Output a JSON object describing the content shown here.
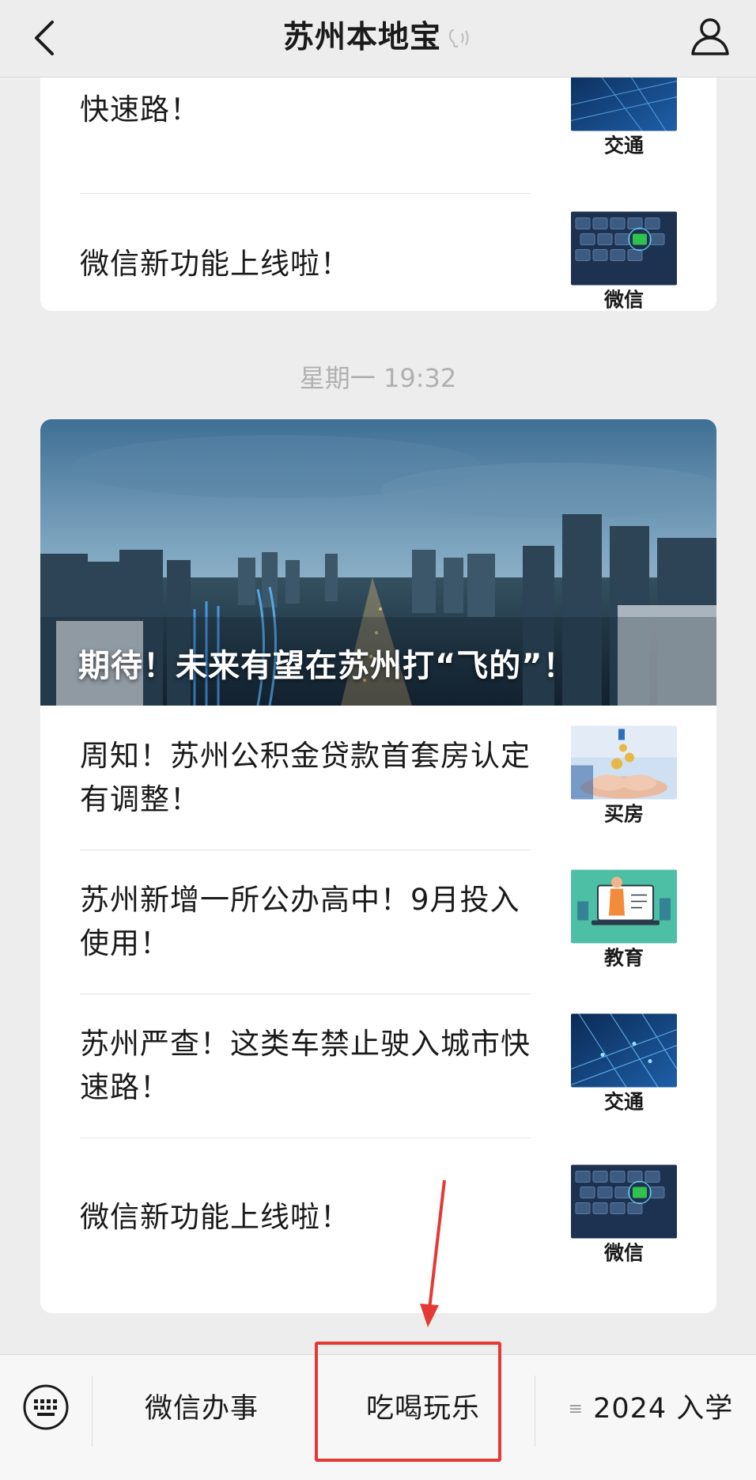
{
  "navbar": {
    "title": "苏州本地宝"
  },
  "top_card": {
    "articles": [
      {
        "title": "快速路！",
        "category": "交通"
      },
      {
        "title": "微信新功能上线啦！",
        "category": "微信"
      }
    ]
  },
  "timestamp": "星期一 19:32",
  "main_card": {
    "hero_title": "期待！未来有望在苏州打“飞的”！",
    "articles": [
      {
        "title": "周知！苏州公积金贷款首套房认定有调整！",
        "category": "买房"
      },
      {
        "title": "苏州新增一所公办高中！9月投入使用！",
        "category": "教育"
      },
      {
        "title": "苏州严查！这类车禁止驶入城市快速路！",
        "category": "交通"
      },
      {
        "title": "微信新功能上线啦！",
        "category": "微信"
      }
    ]
  },
  "bottom_menu": {
    "items": [
      {
        "label": "微信办事"
      },
      {
        "label": "吃喝玩乐"
      },
      {
        "label": "2024 入学"
      }
    ]
  },
  "colors": {
    "background": "#ededed",
    "card": "#ffffff",
    "annotation_red": "#e53935"
  }
}
